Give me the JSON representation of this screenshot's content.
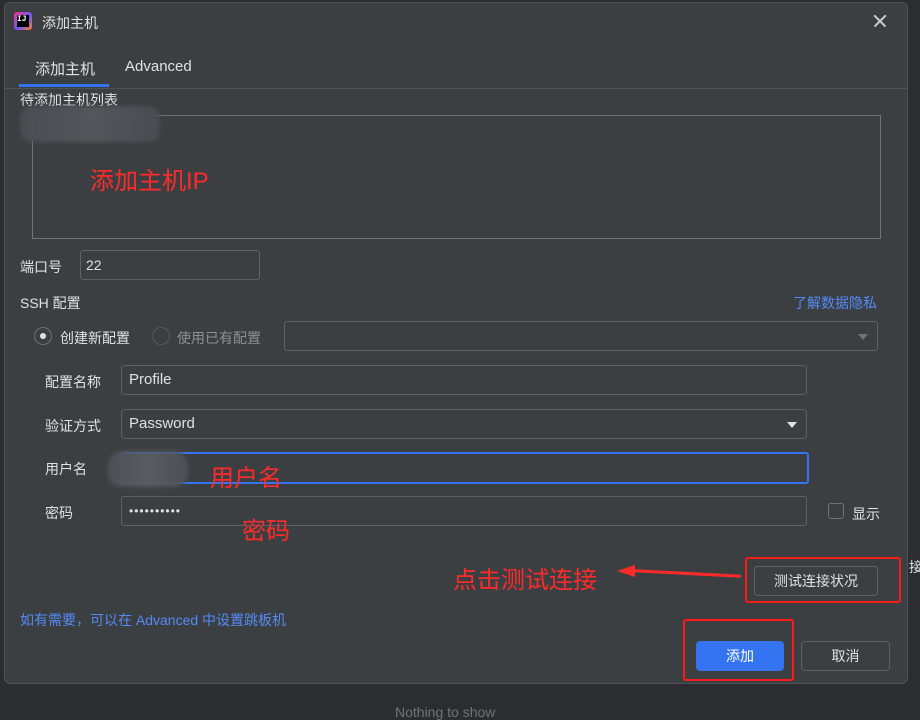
{
  "dialog": {
    "title": "添加主机",
    "tabs": [
      "添加主机",
      "Advanced"
    ]
  },
  "host_list": {
    "label": "待添加主机列表",
    "annotation": "添加主机IP"
  },
  "port": {
    "label": "端口号",
    "value": "22"
  },
  "ssh": {
    "label": "SSH 配置",
    "privacy_link": "了解数据隐私",
    "radio_new": "创建新配置",
    "radio_existing": "使用已有配置",
    "selected": "创建新配置"
  },
  "form": {
    "profile_label": "配置名称",
    "profile_value": "Profile",
    "auth_label": "验证方式",
    "auth_value": "Password",
    "username_label": "用户名",
    "username_annotation": "用户名",
    "password_label": "密码",
    "password_value": "••••••••••",
    "password_annotation": "密码",
    "show_label": "显示",
    "show_checked": false
  },
  "test": {
    "annotation": "点击测试连接",
    "button": "测试连接状况"
  },
  "footer": {
    "hint": "如有需要，可以在 Advanced 中设置跳板机",
    "add_button": "添加",
    "cancel_button": "取消"
  },
  "background": {
    "empty_text": "Nothing to show",
    "right_clip": "接"
  },
  "colors": {
    "accent": "#3574f0",
    "annotation_red": "#ff2a2a",
    "link": "#548af7"
  }
}
